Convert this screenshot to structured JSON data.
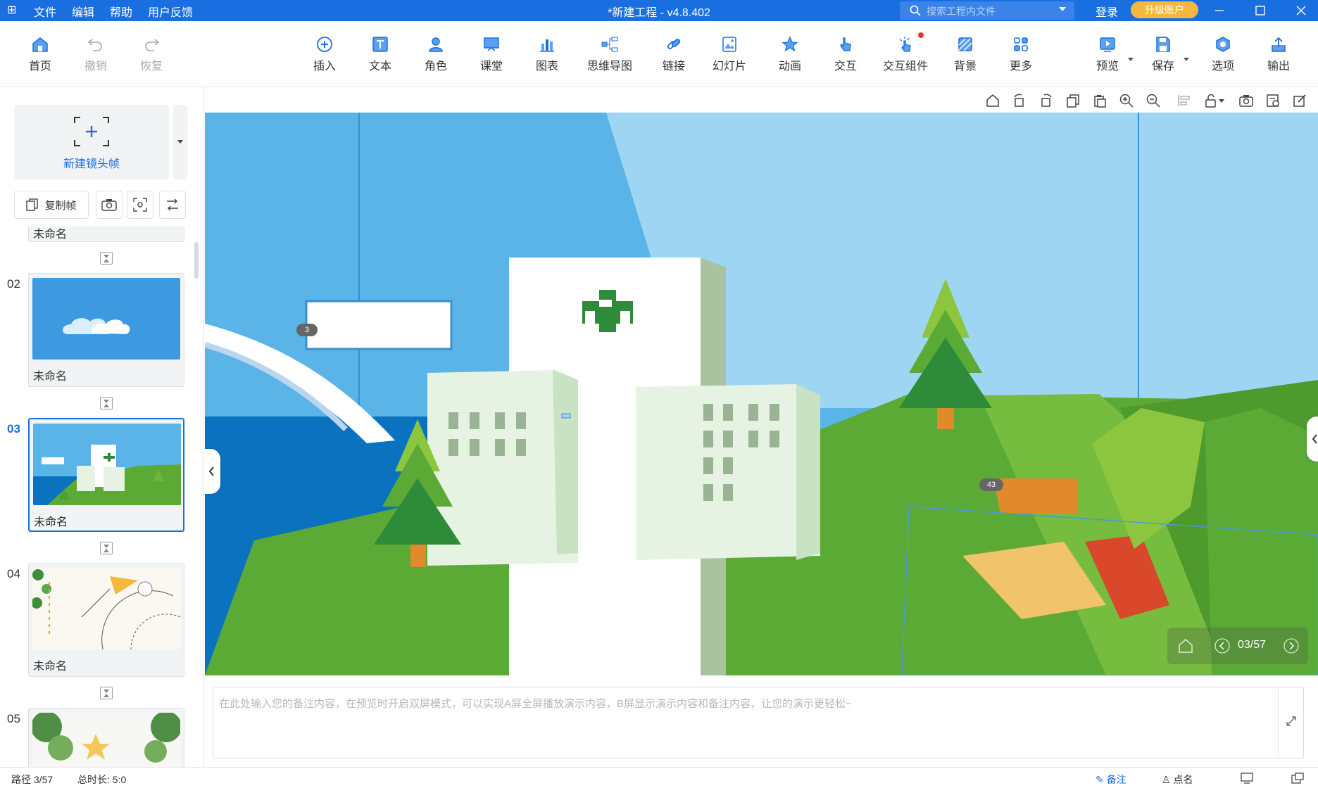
{
  "app": {
    "title": "*新建工程 - v4.8.402",
    "menu": [
      "文件",
      "编辑",
      "帮助",
      "用户反馈"
    ],
    "search_placeholder": "搜索工程内文件",
    "login": "登录",
    "upgrade": "升级账户",
    "accent": "#1a6fe0"
  },
  "toolbar": {
    "left": [
      {
        "label": "首页",
        "icon": "home-icon",
        "enabled": true
      },
      {
        "label": "撤销",
        "icon": "undo-icon",
        "enabled": false
      },
      {
        "label": "恢复",
        "icon": "redo-icon",
        "enabled": false
      }
    ],
    "center": [
      {
        "label": "插入",
        "icon": "plus-circle-icon"
      },
      {
        "label": "文本",
        "icon": "text-icon"
      },
      {
        "label": "角色",
        "icon": "character-icon"
      },
      {
        "label": "课堂",
        "icon": "classroom-icon"
      },
      {
        "label": "图表",
        "icon": "chart-icon"
      },
      {
        "label": "思维导图",
        "icon": "mindmap-icon"
      },
      {
        "label": "链接",
        "icon": "link-icon"
      },
      {
        "label": "幻灯片",
        "icon": "slides-icon"
      },
      {
        "label": "动画",
        "icon": "star-icon"
      },
      {
        "label": "交互",
        "icon": "hand-pointer-icon"
      },
      {
        "label": "交互组件",
        "icon": "click-icon"
      },
      {
        "label": "背景",
        "icon": "background-icon"
      },
      {
        "label": "更多",
        "icon": "grid-icon"
      }
    ],
    "right": [
      {
        "label": "预览",
        "icon": "play-icon"
      },
      {
        "label": "保存",
        "icon": "save-icon"
      },
      {
        "label": "选项",
        "icon": "options-icon"
      },
      {
        "label": "输出",
        "icon": "export-icon"
      }
    ]
  },
  "frames_panel": {
    "new_frame_label": "新建镜头帧",
    "copy_frame_label": "复制帧",
    "partial_item_label": "未命名",
    "slides": [
      {
        "number": "02",
        "name": "未命名",
        "selected": false,
        "theme": "sky-cloud"
      },
      {
        "number": "03",
        "name": "未命名",
        "selected": true,
        "theme": "hospital"
      },
      {
        "number": "04",
        "name": "未命名",
        "selected": false,
        "theme": "paper-plane"
      },
      {
        "number": "05",
        "name": "",
        "selected": false,
        "theme": "leaves-star"
      }
    ]
  },
  "canvas": {
    "badge_textbox": "3",
    "badge_right": "43",
    "pager": "03/57"
  },
  "notes": {
    "placeholder": "在此处输入您的备注内容，在预览时开启双屏模式，可以实现A屏全屏播放演示内容，B屏显示演示内容和备注内容，让您的演示更轻松~"
  },
  "status": {
    "path": "路径 3/57",
    "duration": "总时长: 5:0",
    "notes": "备注",
    "rollcall": "点名"
  }
}
